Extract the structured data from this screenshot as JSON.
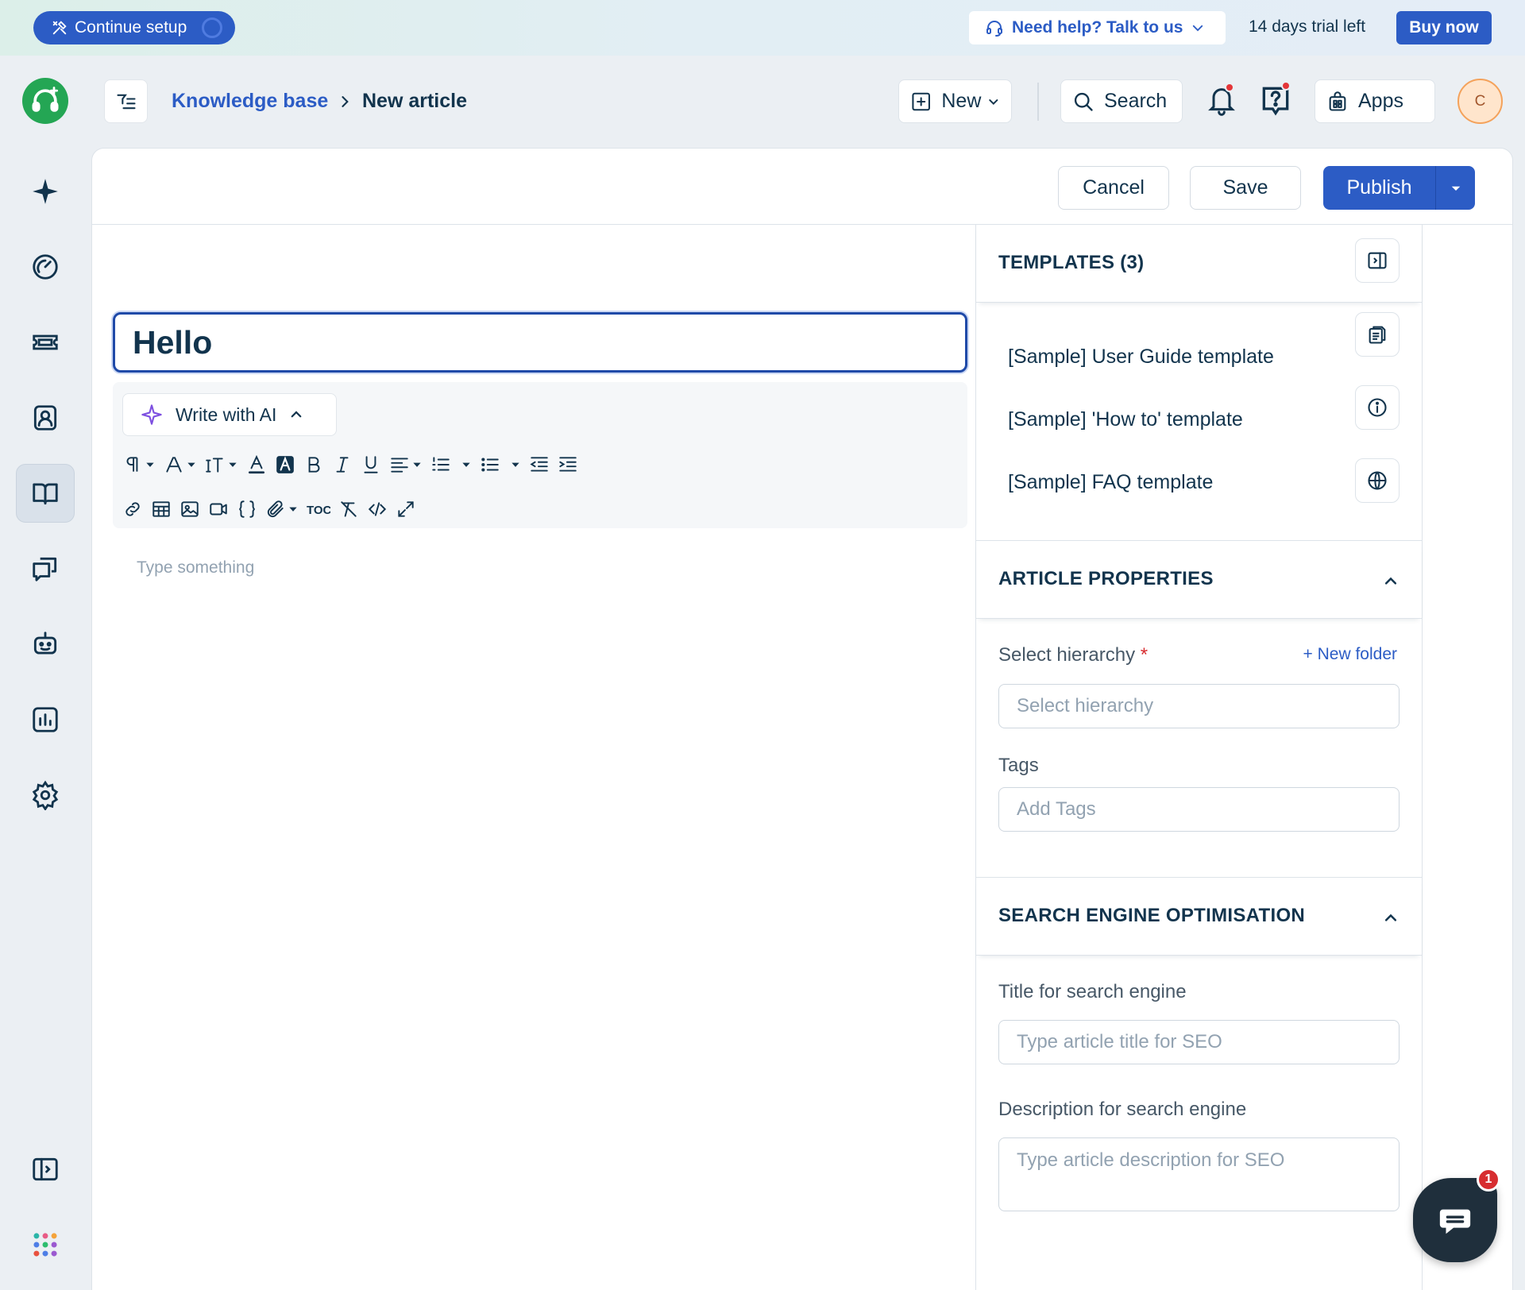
{
  "banner": {
    "setup_label": "Continue setup",
    "help_label": "Need help? Talk to us",
    "trial_text": "14 days trial left",
    "buy_label": "Buy now"
  },
  "header": {
    "breadcrumb_parent": "Knowledge base",
    "breadcrumb_current": "New article",
    "new_label": "New",
    "search_label": "Search",
    "apps_label": "Apps",
    "avatar_initial": "C"
  },
  "actions": {
    "cancel_label": "Cancel",
    "save_label": "Save",
    "publish_label": "Publish"
  },
  "editor": {
    "title_value": "Hello",
    "ai_label": "Write with AI",
    "toc_label": "TOC",
    "body_placeholder": "Type something"
  },
  "templates": {
    "heading": "TEMPLATES (3)",
    "items": [
      "[Sample] User Guide template",
      "[Sample] 'How to' template",
      "[Sample] FAQ template"
    ]
  },
  "properties": {
    "heading": "ARTICLE PROPERTIES",
    "hierarchy_label": "Select hierarchy",
    "required_mark": "*",
    "new_folder_label": "+ New folder",
    "hierarchy_placeholder": "Select hierarchy",
    "tags_label": "Tags",
    "tags_placeholder": "Add Tags"
  },
  "seo": {
    "heading": "SEARCH ENGINE OPTIMISATION",
    "title_label": "Title for search engine",
    "title_placeholder": "Type article title for SEO",
    "desc_label": "Description for search engine",
    "desc_placeholder": "Type article description for SEO"
  },
  "chat": {
    "badge_count": "1"
  },
  "colors": {
    "primary": "#2c5cc5",
    "brand_green": "#24a654",
    "text": "#12344d",
    "alert": "#d72d30"
  }
}
